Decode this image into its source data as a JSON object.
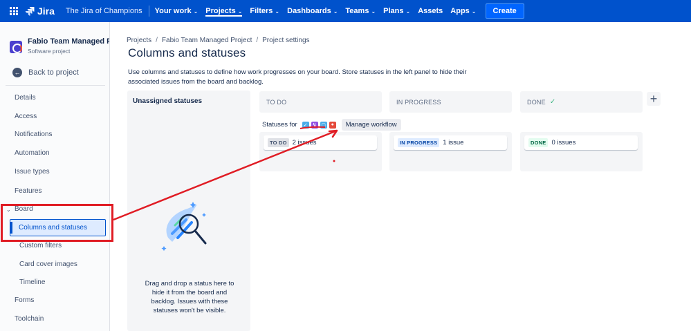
{
  "topbar": {
    "product": "Jira",
    "instance": "The Jira of Champions",
    "nav": [
      {
        "label": "Your work",
        "chevron": true,
        "active": false
      },
      {
        "label": "Projects",
        "chevron": true,
        "active": true
      },
      {
        "label": "Filters",
        "chevron": true,
        "active": false
      },
      {
        "label": "Dashboards",
        "chevron": true,
        "active": false
      },
      {
        "label": "Teams",
        "chevron": true,
        "active": false
      },
      {
        "label": "Plans",
        "chevron": true,
        "active": false
      },
      {
        "label": "Assets",
        "chevron": false,
        "active": false
      },
      {
        "label": "Apps",
        "chevron": true,
        "active": false
      }
    ],
    "create_label": "Create"
  },
  "sidebar": {
    "project_name": "Fabio Team Managed Pr...",
    "project_type": "Software project",
    "back_label": "Back to project",
    "items": [
      "Details",
      "Access",
      "Notifications",
      "Automation",
      "Issue types",
      "Features"
    ],
    "board_label": "Board",
    "board_items": [
      "Columns and statuses",
      "Custom filters",
      "Card cover images",
      "Timeline"
    ],
    "active_item": "Columns and statuses",
    "bottom_items": [
      "Forms",
      "Toolchain"
    ]
  },
  "breadcrumb": [
    "Projects",
    "Fabio Team Managed Project",
    "Project settings"
  ],
  "page_title": "Columns and statuses",
  "description": "Use columns and statuses to define how work progresses on your board. Store statuses in the left panel to hide their associated issues from the board and backlog.",
  "unassigned": {
    "title": "Unassigned statuses",
    "hint": "Drag and drop a status here to hide it from the board and backlog. Issues with these statuses won't be visible."
  },
  "columns": [
    {
      "header": "TO DO",
      "status": "TO DO",
      "count": "2 issues",
      "done_check": false
    },
    {
      "header": "IN PROGRESS",
      "status": "IN PROGRESS",
      "count": "1 issue",
      "done_check": false
    },
    {
      "header": "DONE",
      "status": "DONE",
      "count": "0 issues",
      "done_check": true
    }
  ],
  "statuses_for_label": "Statuses for",
  "issue_type_icons": [
    {
      "name": "task-icon",
      "color": "#4bade8",
      "glyph": "✓"
    },
    {
      "name": "subtask-icon",
      "color": "#904ee2",
      "glyph": "↯"
    },
    {
      "name": "story-icon",
      "color": "#4bade8",
      "glyph": "▢"
    },
    {
      "name": "bug-icon",
      "color": "#e5493a",
      "glyph": "●"
    }
  ],
  "manage_workflow_label": "Manage workflow",
  "colors": {
    "topbar": "#0052cc",
    "annotation_red": "#e01c24"
  }
}
